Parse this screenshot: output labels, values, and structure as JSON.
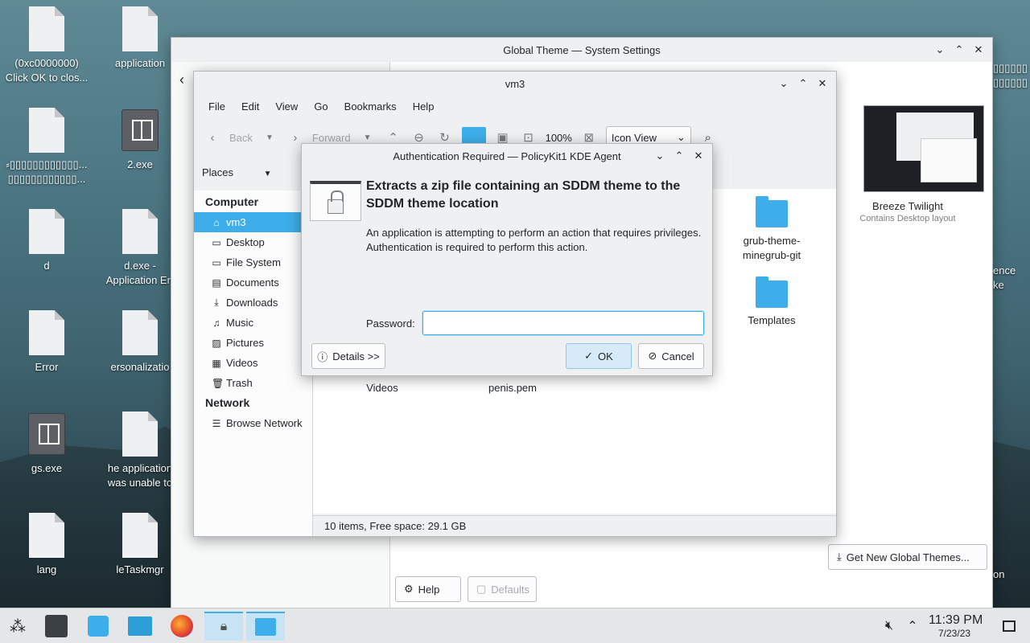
{
  "desktop": {
    "icons": [
      {
        "label": "(0xc0000000)\nClick OK to clos...",
        "type": "file"
      },
      {
        "label": "application",
        "type": "file"
      },
      {
        "label": "⸗▯▯▯▯▯▯▯▯▯▯▯▯...\n▯▯▯▯▯▯▯▯▯▯▯▯...",
        "type": "file"
      },
      {
        "label": "2.exe",
        "type": "exe"
      },
      {
        "label": "d",
        "type": "file"
      },
      {
        "label": "d.exe -\nApplication Err",
        "type": "file"
      },
      {
        "label": "Error",
        "type": "file"
      },
      {
        "label": "ersonalizatio",
        "type": "file"
      },
      {
        "label": "gs.exe",
        "type": "exe"
      },
      {
        "label": "he application\nwas unable to",
        "type": "file"
      },
      {
        "label": "lang",
        "type": "file"
      },
      {
        "label": "leTaskmgr",
        "type": "file"
      }
    ],
    "right_edge_labels": [
      "▯▯▯▯▯▯\n▯▯▯▯▯▯",
      "ence\nke",
      "on"
    ]
  },
  "settings": {
    "title": "Global Theme — System Settings",
    "theme_name": "Breeze Twilight",
    "theme_desc": "Contains Desktop layout",
    "get_new_label": "Get New Global Themes...",
    "help_label": "Help",
    "defaults_label": "Defaults"
  },
  "dolphin": {
    "title": "vm3",
    "menu": [
      "File",
      "Edit",
      "View",
      "Go",
      "Bookmarks",
      "Help"
    ],
    "toolbar": {
      "back": "Back",
      "forward": "Forward",
      "zoom": "100%",
      "view_mode": "Icon View"
    },
    "places_label": "Places",
    "sections": {
      "computer": "Computer",
      "network": "Network"
    },
    "places": [
      {
        "label": "vm3",
        "icon": "home-icon"
      },
      {
        "label": "Desktop",
        "icon": "desktop-icon"
      },
      {
        "label": "File System",
        "icon": "drive-icon"
      },
      {
        "label": "Documents",
        "icon": "documents-icon"
      },
      {
        "label": "Downloads",
        "icon": "downloads-icon"
      },
      {
        "label": "Music",
        "icon": "music-icon"
      },
      {
        "label": "Pictures",
        "icon": "pictures-icon"
      },
      {
        "label": "Videos",
        "icon": "videos-icon"
      },
      {
        "label": "Trash",
        "icon": "trash-icon"
      }
    ],
    "network_items": [
      {
        "label": "Browse Network",
        "icon": "network-icon"
      }
    ],
    "files": [
      {
        "name": "grub-theme-\nminegrub-git"
      },
      {
        "name": "Templates"
      },
      {
        "name": "Videos"
      },
      {
        "name": "penis.pem"
      }
    ],
    "status": "10 items, Free space: 29.1 GB"
  },
  "auth": {
    "title": "Authentication Required — PolicyKit1 KDE Agent",
    "heading": "Extracts a zip file containing an SDDM theme to the SDDM theme location",
    "message": "An application is attempting to perform an action that requires privileges. Authentication is required to perform this action.",
    "password_label": "Password:",
    "password_value": "",
    "details_label": "Details >>",
    "ok_label": "OK",
    "cancel_label": "Cancel"
  },
  "taskbar": {
    "time": "11:39 PM",
    "date": "7/23/23"
  },
  "colors": {
    "accent": "#3daee9",
    "window_bg": "#eff0f1",
    "selection": "#3daee9"
  }
}
